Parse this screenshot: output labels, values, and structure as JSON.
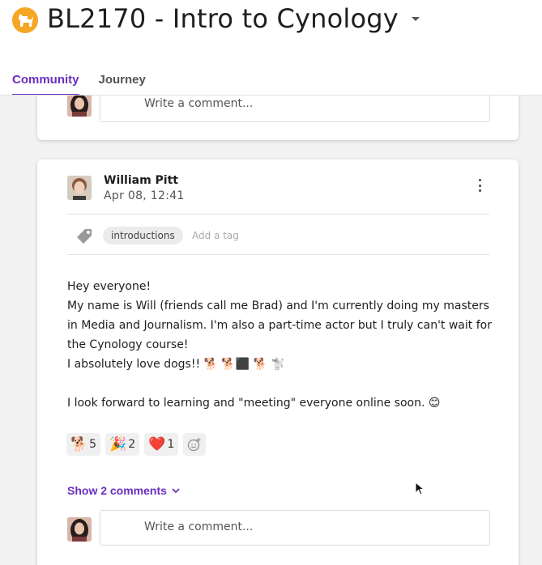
{
  "header": {
    "course_title": "BL2170 - Intro to Cynology",
    "course_icon": "dog-icon",
    "accent_color": "#6b2fbf",
    "tabs": [
      {
        "label": "Community",
        "active": true
      },
      {
        "label": "Journey",
        "active": false
      }
    ]
  },
  "previous_post": {
    "comment_placeholder": "Write a comment..."
  },
  "post": {
    "author": "William Pitt",
    "date": "Apr 08, 12:41",
    "tags": [
      "introductions"
    ],
    "add_tag_placeholder": "Add a tag",
    "body": {
      "line1": "Hey everyone!",
      "line2": "My name is Will (friends call me Brad) and I'm currently doing my masters in Media and Journalism. I'm also a part-time actor but I truly can't wait for the Cynology course!",
      "line3": "I absolutely love dogs!! 🐕 🐕‍⬛ 🐕 🐩",
      "line4": "I look forward to learning and \"meeting\" everyone online soon. 😊"
    },
    "reactions": [
      {
        "emoji": "🐕",
        "count": "5"
      },
      {
        "emoji": "🎉",
        "count": "2"
      },
      {
        "emoji": "❤️",
        "count": "1"
      }
    ],
    "show_comments_label": "Show 2 comments",
    "comment_placeholder": "Write a comment..."
  }
}
